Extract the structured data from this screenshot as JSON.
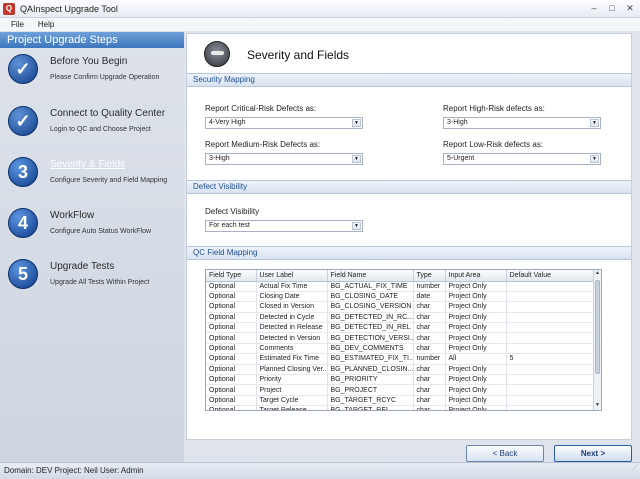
{
  "window": {
    "title": "QAInspect Upgrade Tool",
    "min": "–",
    "max": "□",
    "close": "✕"
  },
  "menu": {
    "file": "File",
    "help": "Help"
  },
  "sidebar": {
    "header": "Project Upgrade Steps",
    "steps": [
      {
        "num": "✓",
        "title": "Before You Begin",
        "sub": "Please Confirm Upgrade Operation",
        "state": "done"
      },
      {
        "num": "✓",
        "title": "Connect to Quality Center",
        "sub": "Login to QC and Choose Project",
        "state": "done"
      },
      {
        "num": "3",
        "title": "Severity & Fields",
        "sub": "Configure Severity and Field Mapping",
        "state": "active"
      },
      {
        "num": "4",
        "title": "WorkFlow",
        "sub": "Configure Auto Status WorkFlow",
        "state": "pending"
      },
      {
        "num": "5",
        "title": "Upgrade Tests",
        "sub": "Upgrade All Tests Within Project",
        "state": "pending"
      }
    ]
  },
  "main": {
    "title": "Severity and Fields",
    "security_mapping": {
      "header": "Security Mapping",
      "critical_label": "Report Critical-Risk Defects as:",
      "critical_value": "4-Very High",
      "high_label": "Report High-Risk defects as:",
      "high_value": "3-High",
      "medium_label": "Report Medium-Risk Defects as:",
      "medium_value": "3-High",
      "low_label": "Report Low-Risk defects as:",
      "low_value": "5-Urgent"
    },
    "defect_visibility": {
      "header": "Defect Visibility",
      "label": "Defect Visibility",
      "value": "For each test"
    },
    "qc_field_mapping": {
      "header": "QC Field Mapping",
      "columns": [
        "Field Type",
        "User Label",
        "Field Name",
        "Type",
        "Input Area",
        "Default Value"
      ],
      "rows": [
        [
          "Optional",
          "Actual Fix Time",
          "BG_ACTUAL_FIX_TIME",
          "number",
          "Project Only",
          ""
        ],
        [
          "Optional",
          "Closing Date",
          "BG_CLOSING_DATE",
          "date",
          "Project Only",
          ""
        ],
        [
          "Optional",
          "Closed in Version",
          "BG_CLOSING_VERSION",
          "char",
          "Project Only",
          ""
        ],
        [
          "Optional",
          "Detected in Cycle",
          "BG_DETECTED_IN_RC...",
          "char",
          "Project Only",
          ""
        ],
        [
          "Optional",
          "Detected in Release",
          "BG_DETECTED_IN_REL",
          "char",
          "Project Only",
          ""
        ],
        [
          "Optional",
          "Detected in Version",
          "BG_DETECTION_VERSI...",
          "char",
          "Project Only",
          ""
        ],
        [
          "Optional",
          "Comments",
          "BG_DEV_COMMENTS",
          "char",
          "Project Only",
          ""
        ],
        [
          "Optional",
          "Estimated Fix Time",
          "BG_ESTIMATED_FIX_TI...",
          "number",
          "All",
          "5"
        ],
        [
          "Optional",
          "Planned Closing Ver...",
          "BG_PLANNED_CLOSIN...",
          "char",
          "Project Only",
          ""
        ],
        [
          "Optional",
          "Priority",
          "BG_PRIORITY",
          "char",
          "Project Only",
          ""
        ],
        [
          "Optional",
          "Project",
          "BG_PROJECT",
          "char",
          "Project Only",
          ""
        ],
        [
          "Optional",
          "Target Cycle",
          "BG_TARGET_RCYC",
          "char",
          "Project Only",
          ""
        ],
        [
          "Optional",
          "Target Release",
          "BG_TARGET_REL",
          "char",
          "Project Only",
          ""
        ]
      ]
    }
  },
  "buttons": {
    "back": "< Back",
    "next": "Next >"
  },
  "status": "Domain: DEV Project: Neil User: Admin"
}
